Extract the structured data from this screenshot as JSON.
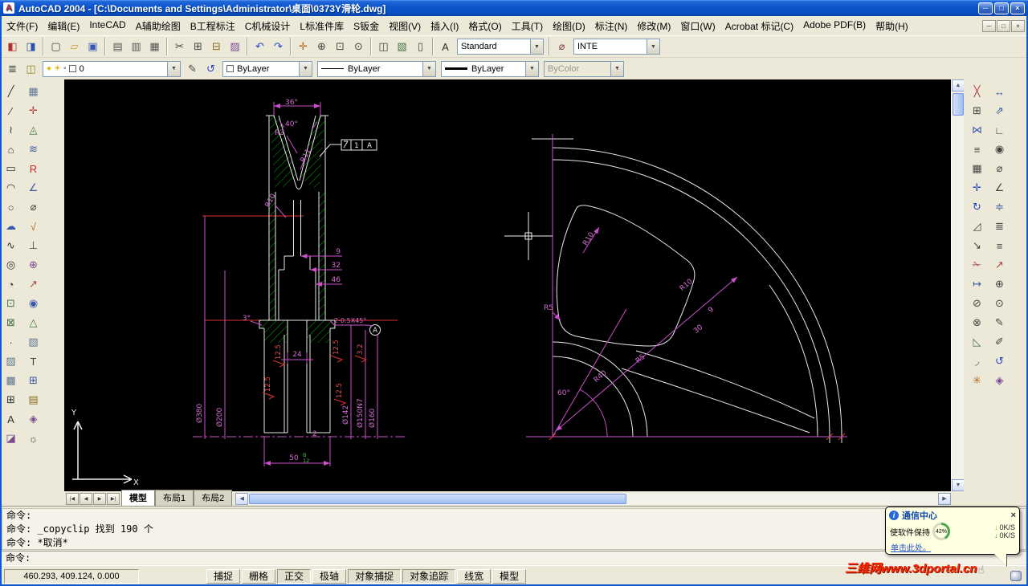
{
  "titlebar": {
    "icon": "A",
    "title": "AutoCAD 2004 - [C:\\Documents and Settings\\Administrator\\桌面\\0373Y滑轮.dwg]",
    "buttons": [
      {
        "name": "minimize-button",
        "glyph": "─"
      },
      {
        "name": "maximize-button",
        "glyph": "□"
      },
      {
        "name": "close-button",
        "glyph": "×"
      }
    ]
  },
  "menubar": {
    "items": [
      {
        "name": "menu-file",
        "label": "文件(F)"
      },
      {
        "name": "menu-edit",
        "label": "编辑(E)"
      },
      {
        "name": "menu-intecad",
        "label": "InteCAD"
      },
      {
        "name": "menu-aux-draw",
        "label": "A辅助绘图"
      },
      {
        "name": "menu-eng-dim",
        "label": "B工程标注"
      },
      {
        "name": "menu-mech-design",
        "label": "C机械设计"
      },
      {
        "name": "menu-std-parts",
        "label": "L标准件库"
      },
      {
        "name": "menu-sheet-metal",
        "label": "S钣金"
      },
      {
        "name": "menu-view",
        "label": "视图(V)"
      },
      {
        "name": "menu-insert",
        "label": "插入(I)"
      },
      {
        "name": "menu-format",
        "label": "格式(O)"
      },
      {
        "name": "menu-tools",
        "label": "工具(T)"
      },
      {
        "name": "menu-draw",
        "label": "绘图(D)"
      },
      {
        "name": "menu-dimension",
        "label": "标注(N)"
      },
      {
        "name": "menu-modify",
        "label": "修改(M)"
      },
      {
        "name": "menu-window",
        "label": "窗口(W)"
      },
      {
        "name": "menu-acrobat-comments",
        "label": "Acrobat 标记(C)"
      },
      {
        "name": "menu-adobe-pdf",
        "label": "Adobe PDF(B)"
      },
      {
        "name": "menu-help",
        "label": "帮助(H)"
      }
    ],
    "window_buttons": [
      {
        "name": "doc-minimize-button",
        "glyph": "─"
      },
      {
        "name": "doc-restore-button",
        "glyph": "□"
      },
      {
        "name": "doc-close-button",
        "glyph": "×"
      }
    ]
  },
  "toolbars": {
    "row1": [
      {
        "name": "intecad-tool-button",
        "glyph": "◧",
        "color": "#b03030"
      },
      {
        "name": "intecad-palette-button",
        "glyph": "◨",
        "color": "#3050b0"
      },
      {
        "sep": true
      },
      {
        "name": "qnew-button",
        "glyph": "▢",
        "color": "#444444"
      },
      {
        "name": "open-button",
        "glyph": "▱",
        "color": "#c8a030"
      },
      {
        "name": "save-button",
        "glyph": "▣",
        "color": "#3858b8"
      },
      {
        "sep": true
      },
      {
        "name": "plot-button",
        "glyph": "▤",
        "color": "#555555"
      },
      {
        "name": "plot-preview-button",
        "glyph": "▥",
        "color": "#555555"
      },
      {
        "name": "publish-button",
        "glyph": "▦",
        "color": "#555555"
      },
      {
        "sep": true
      },
      {
        "name": "cut-button",
        "glyph": "✂",
        "color": "#444444"
      },
      {
        "name": "copy-button",
        "glyph": "⊞",
        "color": "#444444"
      },
      {
        "name": "paste-button",
        "glyph": "⊟",
        "color": "#8a6a20"
      },
      {
        "name": "match-properties-button",
        "glyph": "▨",
        "color": "#7a4a90"
      },
      {
        "sep": true
      },
      {
        "name": "undo-button",
        "glyph": "↶",
        "color": "#2848c0"
      },
      {
        "name": "redo-button",
        "glyph": "↷",
        "color": "#2848c0"
      },
      {
        "sep": true
      },
      {
        "name": "pan-button",
        "glyph": "✛",
        "color": "#b06820"
      },
      {
        "name": "zoom-realtime-button",
        "glyph": "⊕",
        "color": "#444444"
      },
      {
        "name": "zoom-window-button",
        "glyph": "⊡",
        "color": "#444444"
      },
      {
        "name": "zoom-previous-button",
        "glyph": "⊙",
        "color": "#444444"
      },
      {
        "sep": true
      },
      {
        "name": "properties-button",
        "glyph": "◫",
        "color": "#444444"
      },
      {
        "name": "design-center-button",
        "glyph": "▧",
        "color": "#447044"
      },
      {
        "name": "tool-palettes-button",
        "glyph": "▯",
        "color": "#444444"
      },
      {
        "sep": true
      },
      {
        "name": "text-style-button",
        "glyph": "A",
        "color": "#303030"
      }
    ],
    "row1_dim_icon": [
      {
        "name": "dim-style-icon-button",
        "glyph": "⌀",
        "color": "#804040"
      }
    ],
    "style_combo": {
      "value": "Standard"
    },
    "dim_combo": {
      "value": "INTE"
    },
    "row2_g1": [
      {
        "name": "layer-properties-button",
        "glyph": "≣",
        "color": "#444444"
      },
      {
        "name": "layer-states-button",
        "glyph": "◫",
        "color": "#888820"
      }
    ],
    "layer_combo": {
      "value": "0",
      "chips": [
        {
          "name": "layer-on-icon",
          "glyph": "●",
          "color": "#e0c000"
        },
        {
          "name": "layer-thaw-icon",
          "glyph": "☀",
          "color": "#e0a800"
        },
        {
          "name": "layer-unlock-icon",
          "glyph": "▪",
          "color": "#9a9a9a"
        }
      ]
    },
    "row2_g2": [
      {
        "name": "make-object-layer-current-button",
        "glyph": "✎",
        "color": "#444444"
      },
      {
        "name": "layer-previous-button",
        "glyph": "↺",
        "color": "#2848c0"
      }
    ],
    "color_combo": {
      "value": "ByLayer"
    },
    "linetype_combo": {
      "value": "ByLayer"
    },
    "lineweight_combo": {
      "value": "ByLayer"
    },
    "plotstyle_combo": {
      "value": "ByColor"
    },
    "dropdown_glyph": "▼"
  },
  "docks": {
    "left1": [
      {
        "name": "line-tool",
        "glyph": "╱",
        "color": "#333333"
      },
      {
        "name": "construction-line-tool",
        "glyph": "∕",
        "color": "#333333"
      },
      {
        "name": "polyline-tool",
        "glyph": "≀",
        "color": "#333333"
      },
      {
        "name": "polygon-tool",
        "glyph": "⌂",
        "color": "#333333"
      },
      {
        "name": "rectangle-tool",
        "glyph": "▭",
        "color": "#333333"
      },
      {
        "name": "arc-tool",
        "glyph": "◠",
        "color": "#333333"
      },
      {
        "name": "circle-tool",
        "glyph": "○",
        "color": "#333333"
      },
      {
        "name": "revision-cloud-tool",
        "glyph": "☁",
        "color": "#3858a8"
      },
      {
        "name": "spline-tool",
        "glyph": "∿",
        "color": "#333333"
      },
      {
        "name": "ellipse-tool",
        "glyph": "◎",
        "color": "#333333"
      },
      {
        "name": "ellipse-arc-tool",
        "glyph": "◔",
        "color": "#333333"
      },
      {
        "name": "insert-block-tool",
        "glyph": "⊡",
        "color": "#447044"
      },
      {
        "name": "make-block-tool",
        "glyph": "⊠",
        "color": "#447044"
      },
      {
        "name": "point-tool",
        "glyph": "∙",
        "color": "#333333"
      },
      {
        "name": "hatch-tool",
        "glyph": "▨",
        "color": "#607890"
      },
      {
        "name": "region-tool",
        "glyph": "▩",
        "color": "#607890"
      },
      {
        "name": "table-tool",
        "glyph": "⊞",
        "color": "#333333"
      },
      {
        "name": "mtext-tool",
        "glyph": "A",
        "color": "#333333"
      },
      {
        "name": "gradient-tool",
        "glyph": "◪",
        "color": "#7a4a90"
      }
    ],
    "left2": [
      {
        "name": "caxa-grid-tool",
        "glyph": "▦",
        "color": "#607890"
      },
      {
        "name": "caxa-center-line-tool",
        "glyph": "✛",
        "color": "#b04040"
      },
      {
        "name": "caxa-section-tool",
        "glyph": "◬",
        "color": "#447044"
      },
      {
        "name": "caxa-break-line-tool",
        "glyph": "≋",
        "color": "#3858a8"
      },
      {
        "name": "caxa-radius-tool",
        "glyph": "R",
        "color": "#c03030"
      },
      {
        "name": "caxa-angle-tool",
        "glyph": "∠",
        "color": "#3858a8"
      },
      {
        "name": "caxa-diameter-tool",
        "glyph": "⌀",
        "color": "#444444"
      },
      {
        "name": "caxa-roughness-tool",
        "glyph": "√",
        "color": "#b06820"
      },
      {
        "name": "caxa-datum-tool",
        "glyph": "⊥",
        "color": "#444444"
      },
      {
        "name": "caxa-tolerance-tool",
        "glyph": "⊕",
        "color": "#7a4a90"
      },
      {
        "name": "caxa-leader-tool",
        "glyph": "↗",
        "color": "#b04040"
      },
      {
        "name": "caxa-balloon-tool",
        "glyph": "◉",
        "color": "#3858a8"
      },
      {
        "name": "caxa-weld-tool",
        "glyph": "△",
        "color": "#447044"
      },
      {
        "name": "caxa-hatch-tool",
        "glyph": "▧",
        "color": "#607890"
      },
      {
        "name": "caxa-text-tool",
        "glyph": "T",
        "color": "#444444"
      },
      {
        "name": "caxa-table-tool",
        "glyph": "⊞",
        "color": "#3858a8"
      },
      {
        "name": "caxa-title-block-tool",
        "glyph": "▤",
        "color": "#8a6a20"
      },
      {
        "name": "caxa-library-tool",
        "glyph": "◈",
        "color": "#7a4a90"
      },
      {
        "name": "caxa-settings-tool",
        "glyph": "☼",
        "color": "#444444"
      }
    ],
    "right1": [
      {
        "name": "erase-tool",
        "glyph": "╳",
        "color": "#b04040"
      },
      {
        "name": "copy-object-tool",
        "glyph": "⊞",
        "color": "#444444"
      },
      {
        "name": "mirror-tool",
        "glyph": "⋈",
        "color": "#3858a8"
      },
      {
        "name": "offset-tool",
        "glyph": "≡",
        "color": "#444444"
      },
      {
        "name": "array-tool",
        "glyph": "▦",
        "color": "#444444"
      },
      {
        "name": "move-tool",
        "glyph": "✛",
        "color": "#2848c0"
      },
      {
        "name": "rotate-tool",
        "glyph": "↻",
        "color": "#2848c0"
      },
      {
        "name": "scale-tool",
        "glyph": "◿",
        "color": "#444444"
      },
      {
        "name": "stretch-tool",
        "glyph": "↘",
        "color": "#444444"
      },
      {
        "name": "trim-tool",
        "glyph": "✁",
        "color": "#b04040"
      },
      {
        "name": "extend-tool",
        "glyph": "↦",
        "color": "#3858a8"
      },
      {
        "name": "break-point-tool",
        "glyph": "⊘",
        "color": "#444444"
      },
      {
        "name": "break-tool",
        "glyph": "⊗",
        "color": "#444444"
      },
      {
        "name": "chamfer-tool",
        "glyph": "◺",
        "color": "#447044"
      },
      {
        "name": "fillet-tool",
        "glyph": "◞",
        "color": "#447044"
      },
      {
        "name": "explode-tool",
        "glyph": "✳",
        "color": "#b06820"
      }
    ],
    "right2": [
      {
        "name": "linear-dimension-tool",
        "glyph": "↔",
        "color": "#3858a8"
      },
      {
        "name": "aligned-dimension-tool",
        "glyph": "⇗",
        "color": "#3858a8"
      },
      {
        "name": "ordinate-dimension-tool",
        "glyph": "∟",
        "color": "#444444"
      },
      {
        "name": "radius-dimension-tool",
        "glyph": "◉",
        "color": "#444444"
      },
      {
        "name": "diameter-dimension-tool",
        "glyph": "⌀",
        "color": "#444444"
      },
      {
        "name": "angular-dimension-tool",
        "glyph": "∠",
        "color": "#444444"
      },
      {
        "name": "quick-dimension-tool",
        "glyph": "≑",
        "color": "#3858a8"
      },
      {
        "name": "baseline-dimension-tool",
        "glyph": "≣",
        "color": "#444444"
      },
      {
        "name": "continue-dimension-tool",
        "glyph": "≡",
        "color": "#444444"
      },
      {
        "name": "quick-leader-tool",
        "glyph": "↗",
        "color": "#b04040"
      },
      {
        "name": "tolerance-tool",
        "glyph": "⊕",
        "color": "#444444"
      },
      {
        "name": "center-mark-tool",
        "glyph": "⊙",
        "color": "#444444"
      },
      {
        "name": "dimension-edit-tool",
        "glyph": "✎",
        "color": "#444444"
      },
      {
        "name": "dimension-text-edit-tool",
        "glyph": "✐",
        "color": "#444444"
      },
      {
        "name": "dimension-update-tool",
        "glyph": "↺",
        "color": "#2848c0"
      },
      {
        "name": "dimension-style-tool",
        "glyph": "◈",
        "color": "#7a4a90"
      }
    ]
  },
  "scrollbars": {
    "up": "▲",
    "down": "▼",
    "left": "◀",
    "right": "▶"
  },
  "tabs": {
    "nav": [
      {
        "name": "tab-first-button",
        "glyph": "|◀"
      },
      {
        "name": "tab-prev-button",
        "glyph": "◀"
      },
      {
        "name": "tab-next-button",
        "glyph": "▶"
      },
      {
        "name": "tab-last-button",
        "glyph": "▶|"
      }
    ],
    "items": [
      {
        "name": "tab-model",
        "label": "模型",
        "active": true
      },
      {
        "name": "tab-layout1",
        "label": "布局1"
      },
      {
        "name": "tab-layout2",
        "label": "布局2"
      }
    ]
  },
  "command": {
    "history": [
      "命令:",
      "命令: _copyclip 找到 190 个",
      "命令: *取消*"
    ],
    "prompt": "命令:"
  },
  "statusbar": {
    "coords": "460.293, 409.124, 0.000",
    "buttons": [
      {
        "name": "snap-toggle",
        "label": "捕捉"
      },
      {
        "name": "grid-toggle",
        "label": "栅格"
      },
      {
        "name": "ortho-toggle",
        "label": "正交",
        "active": true
      },
      {
        "name": "polar-toggle",
        "label": "极轴"
      },
      {
        "name": "osnap-toggle",
        "label": "对象捕捉",
        "active": true
      },
      {
        "name": "otrack-toggle",
        "label": "对象追踪",
        "active": true
      },
      {
        "name": "lineweight-toggle",
        "label": "线宽"
      },
      {
        "name": "model-space-button",
        "label": "模型"
      }
    ]
  },
  "comm_center": {
    "title": "通信中心",
    "info_glyph": "i",
    "message": "使软件保持",
    "percent": "42%",
    "rates": [
      {
        "name": "download-rate",
        "arrow": "↓",
        "color": "#d09010",
        "value": "0K/S"
      },
      {
        "name": "upload-rate",
        "arrow": "↓",
        "color": "#30a030",
        "value": "0K/S"
      }
    ],
    "link": "单击此处。",
    "close_glyph": "×"
  },
  "watermark": {
    "text": "三维网www.3dportal.cn",
    "hand": "☝"
  },
  "drawing": {
    "colors": {
      "object_line": "#e8e8e8",
      "dimension": "#cc4fcc",
      "hatch": "#00a800",
      "construction": "#e03030",
      "tolerance_text": "#3ec43e",
      "background": "#000000"
    },
    "dims": {
      "angle36": "36°",
      "angle40": "40°",
      "r3": "R3",
      "r11": "R11",
      "r10": "R10",
      "w9": "9",
      "w32": "32",
      "w46": "46",
      "deg3": "3°",
      "chamfer": "2-0.5X45°",
      "fcf_tol": "1",
      "fcf_datum": "A",
      "datum": "A",
      "roughness": "12.5",
      "roughness2": "3.2",
      "dia380": "Ø380",
      "dia200": "Ø200",
      "dia142": "Ø142",
      "dia150": "Ø150N7",
      "dia160": "Ø160",
      "w24": "24",
      "w2": "2",
      "w50": "50",
      "tol_top": "B",
      "tol_bot": "12",
      "r40": "R40",
      "r5": "R5",
      "n9": "9",
      "n30": "30",
      "deg60": "60°",
      "ucs_x": "X",
      "ucs_y": "Y"
    }
  }
}
